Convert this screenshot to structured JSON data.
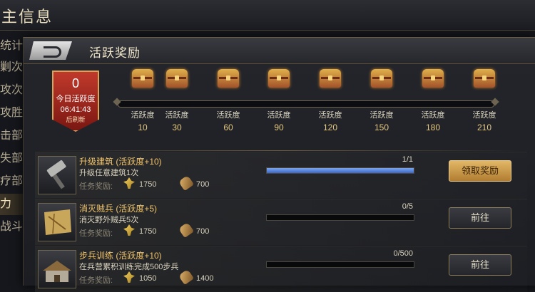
{
  "background": {
    "title": "主信息",
    "side_items": [
      "统计",
      "剿次数",
      "攻次数",
      "攻胜利",
      "击部队",
      "失部队",
      "疗部队",
      "力",
      "战斗力"
    ],
    "active_index": 7
  },
  "panel": {
    "title": "活跃奖励"
  },
  "badge": {
    "value": "0",
    "label": "今日活跃度",
    "time": "06:41:43",
    "refresh": "后刷新"
  },
  "milestones": [
    {
      "label": "活跃度",
      "value": "10"
    },
    {
      "label": "活跃度",
      "value": "30"
    },
    {
      "label": "活跃度",
      "value": "60"
    },
    {
      "label": "活跃度",
      "value": "90"
    },
    {
      "label": "活跃度",
      "value": "120"
    },
    {
      "label": "活跃度",
      "value": "150"
    },
    {
      "label": "活跃度",
      "value": "180"
    },
    {
      "label": "活跃度",
      "value": "210"
    }
  ],
  "tasks": [
    {
      "icon": "hammer-icon",
      "title": "升级建筑 (活跃度+10)",
      "desc": "升级任意建筑1次",
      "reward_label": "任务奖励:",
      "reward_food": "1750",
      "reward_wood": "700",
      "count": "1/1",
      "progress": 1.0,
      "button": "领取奖励",
      "button_style": "gold"
    },
    {
      "icon": "map-icon",
      "title": "消灭贼兵 (活跃度+5)",
      "desc": "消灭野外贼兵5次",
      "reward_label": "任务奖励:",
      "reward_food": "1750",
      "reward_wood": "700",
      "count": "0/5",
      "progress": 0.0,
      "button": "前往",
      "button_style": "dark"
    },
    {
      "icon": "barracks-icon",
      "title": "步兵训练 (活跃度+10)",
      "desc": "在兵营累积训练完成500步兵",
      "reward_label": "任务奖励:",
      "reward_food": "1050",
      "reward_wood": "1400",
      "count": "0/500",
      "progress": 0.0,
      "button": "前往",
      "button_style": "dark"
    }
  ]
}
